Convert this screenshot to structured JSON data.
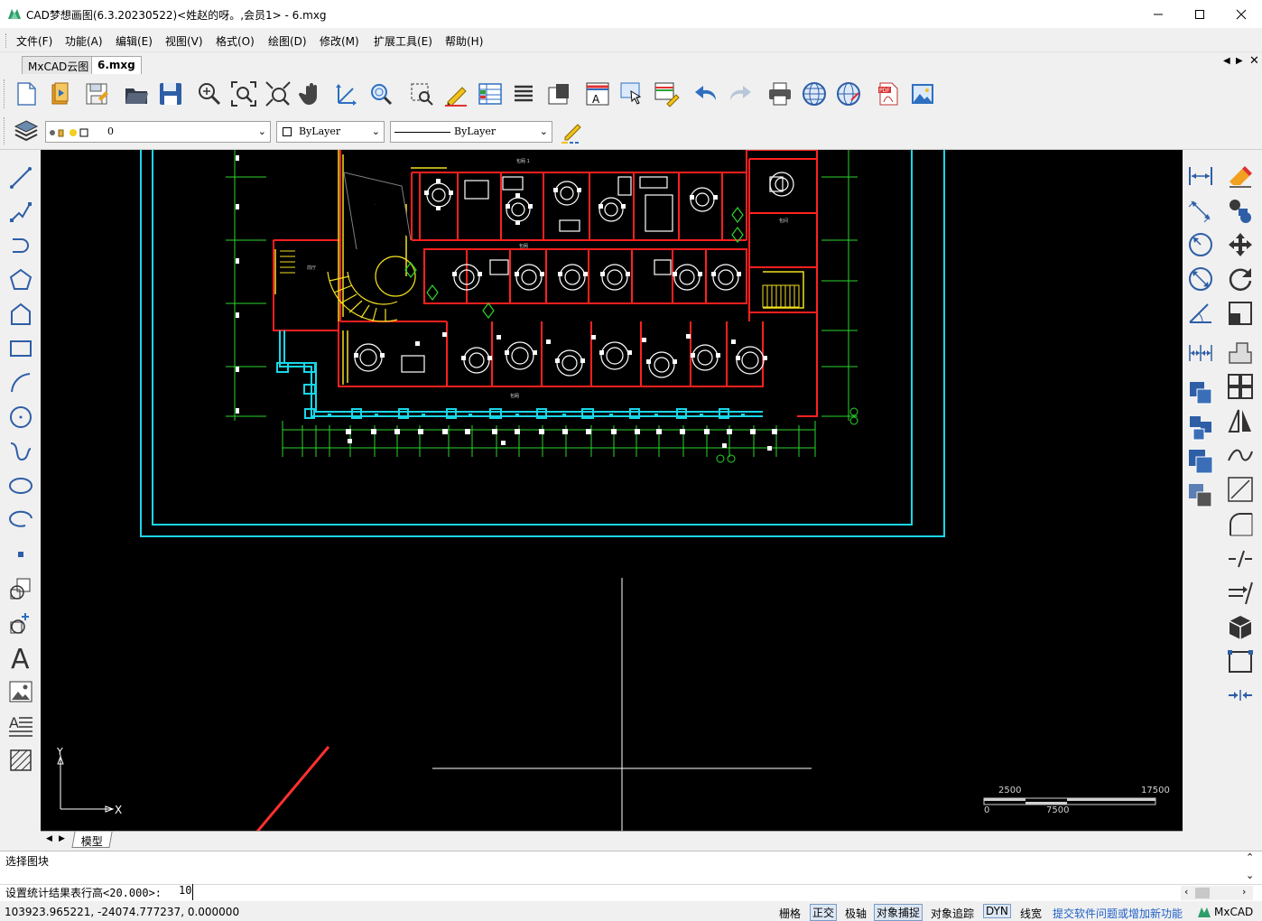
{
  "window": {
    "title": "CAD梦想画图(6.3.20230522)<姓赵的呀。,会员1> - 6.mxg"
  },
  "menu": [
    "文件(F)",
    "功能(A)",
    "编辑(E)",
    "视图(V)",
    "格式(O)",
    "绘图(D)",
    "修改(M)",
    "扩展工具(E)",
    "帮助(H)"
  ],
  "tabs": [
    "MxCAD云图",
    "6.mxg"
  ],
  "properties": {
    "layer": "0",
    "color": "ByLayer",
    "linetype": "ByLayer"
  },
  "layout_tabs": [
    "模型"
  ],
  "scale_bar": {
    "top_labels": [
      "2500",
      "17500"
    ],
    "bottom_labels": [
      "0",
      "7500"
    ]
  },
  "ucs": {
    "x_label": "X",
    "y_label": "Y"
  },
  "command": {
    "history_line": "选择图块",
    "prompt": "设置统计结果表行高<20.000>:",
    "input": "10"
  },
  "status": {
    "coords": "103923.965221,  -24074.777237,  0.000000",
    "toggles": [
      {
        "label": "栅格",
        "on": false
      },
      {
        "label": "正交",
        "on": true
      },
      {
        "label": "极轴",
        "on": false
      },
      {
        "label": "对象捕捉",
        "on": true
      },
      {
        "label": "对象追踪",
        "on": false
      },
      {
        "label": "DYN",
        "on": true
      },
      {
        "label": "线宽",
        "on": false
      }
    ],
    "feedback_link": "提交软件问题或增加新功能",
    "brand": "MxCAD"
  },
  "colors": {
    "accent": "#1e60c8",
    "canvas": "#000000",
    "wall": "#ff2020",
    "cyan": "#19d6e8",
    "annotation": "#2bd62b",
    "arrow": "#ff3030"
  }
}
